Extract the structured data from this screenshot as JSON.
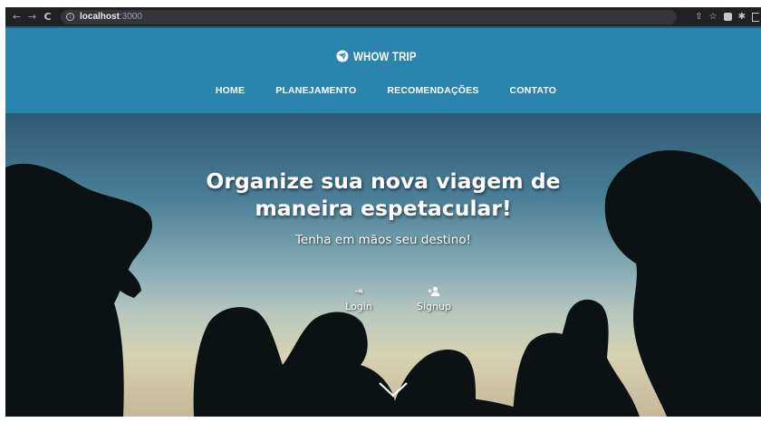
{
  "browser": {
    "url_host": "localhost",
    "url_port": ":3000",
    "icons": [
      "back-icon",
      "forward-icon",
      "reload-icon",
      "info-icon",
      "share-icon",
      "bookmark-star-icon",
      "extension-icon",
      "puzzle-icon",
      "profile-icon"
    ]
  },
  "header": {
    "brand": "WHOW TRIP",
    "brand_icon": "globe-plane-icon",
    "background": "#2a84ad",
    "menu": [
      {
        "label": "HOME"
      },
      {
        "label": "PLANEJAMENTO"
      },
      {
        "label": "RECOMENDAÇÕES"
      },
      {
        "label": "CONTATO"
      }
    ]
  },
  "hero": {
    "title_line1": "Organize sua nova viagem de",
    "title_line2": "maneira espetacular!",
    "subtitle": "Tenha em mãos seu destino!",
    "actions": [
      {
        "label": "Login",
        "icon": "login-icon"
      },
      {
        "label": "Signup",
        "icon": "person-add-icon"
      }
    ],
    "scroll_icon": "chevron-down-icon"
  }
}
